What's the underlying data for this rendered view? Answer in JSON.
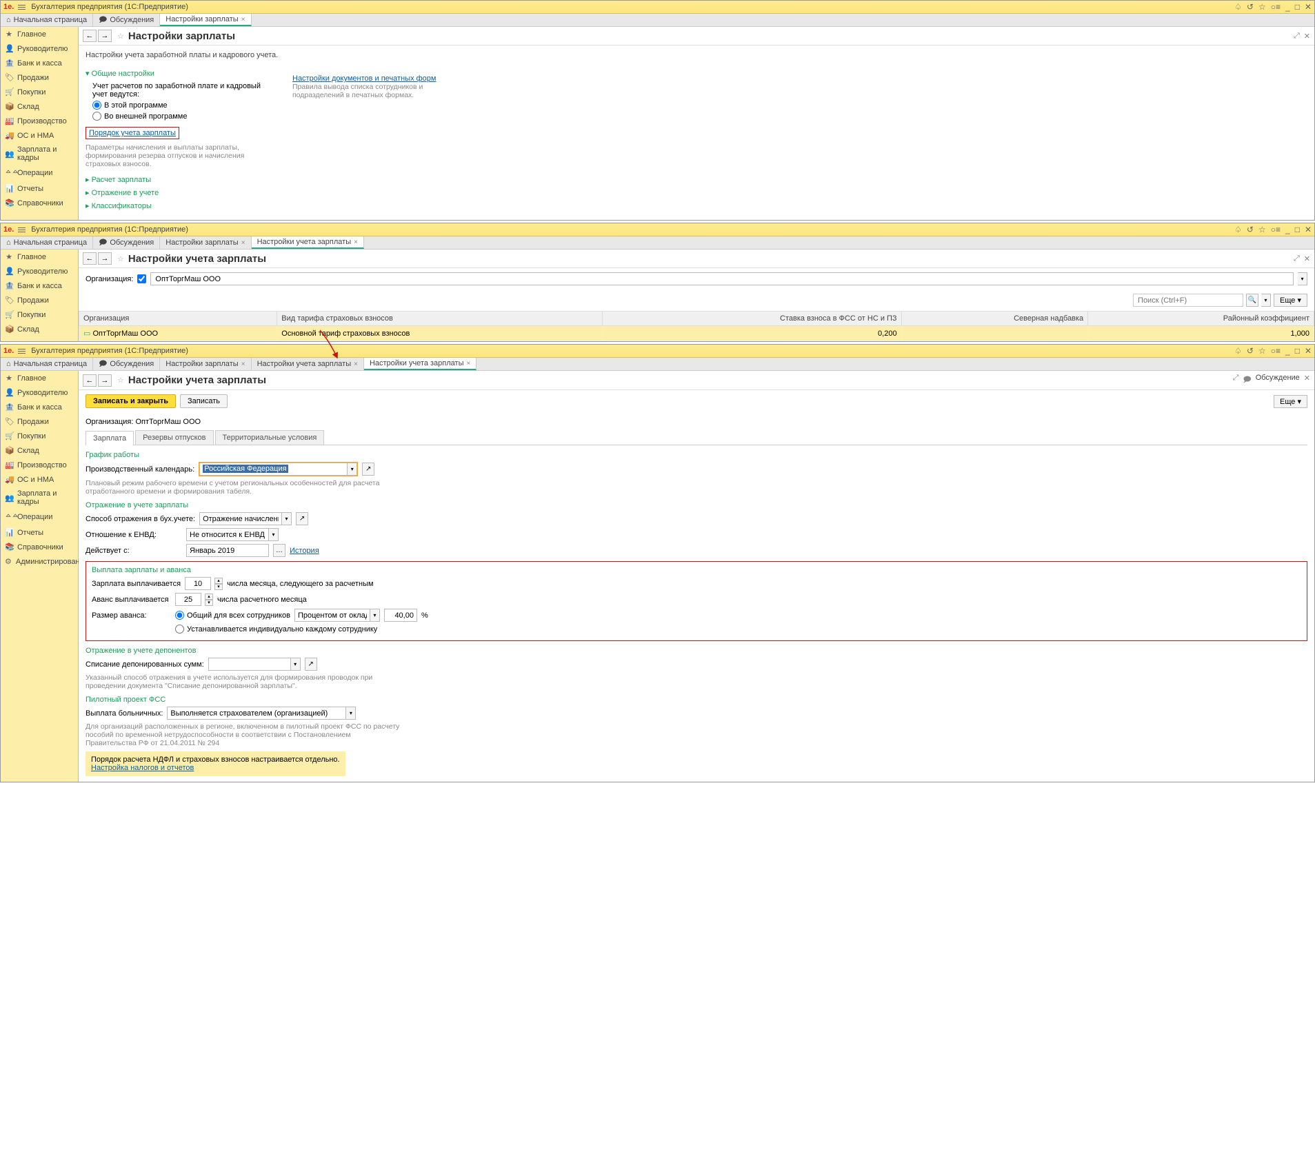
{
  "app_title": "Бухгалтерия предприятия  (1С:Предприятие)",
  "tabs": {
    "home": "Начальная страница",
    "discuss": "Обсуждения",
    "t1": "Настройки зарплаты",
    "t2": "Настройки учета зарплаты",
    "t3": "Настройки учета зарплаты"
  },
  "side": [
    "Главное",
    "Руководителю",
    "Банк и касса",
    "Продажи",
    "Покупки",
    "Склад",
    "Производство",
    "ОС и НМА",
    "Зарплата и кадры",
    "Операции",
    "Отчеты",
    "Справочники",
    "Администрирование"
  ],
  "icons": [
    "★",
    "👤",
    "🏦",
    "🏷",
    "🛒",
    "📦",
    "🏭",
    "🚚",
    "👥",
    "ᅀᅀ",
    "📊",
    "📚",
    "⚙"
  ],
  "w1": {
    "title": "Настройки зарплаты",
    "sub": "Настройки учета заработной платы и кадрового учета.",
    "s_general": "Общие настройки",
    "lead": "Учет расчетов по заработной плате и кадровый учет ведутся:",
    "r1": "В этой программе",
    "r2": "Во внешней программе",
    "link_order": "Порядок учета зарплаты",
    "hint_order": "Параметры начисления и выплаты зарплаты, формирования резерва отпусков и начисления страховых взносов.",
    "link_docs": "Настройки документов и печатных форм",
    "hint_docs": "Правила вывода списка сотрудников и подразделений в печатных формах.",
    "s_calc": "Расчет зарплаты",
    "s_refl": "Отражение в учете",
    "s_class": "Классификаторы"
  },
  "w2": {
    "title": "Настройки учета зарплаты",
    "org_label": "Организация:",
    "org_val": "ОптТоргМаш ООО",
    "search_ph": "Поиск (Ctrl+F)",
    "more": "Еще",
    "th": [
      "Организация",
      "Вид тарифа страховых взносов",
      "Ставка взноса в ФСС от НС и ПЗ",
      "Северная надбавка",
      "Районный коэффициент"
    ],
    "row": [
      "ОптТоргМаш ООО",
      "Основной тариф страховых взносов",
      "0,200",
      "",
      "1,000"
    ]
  },
  "w3": {
    "title": "Настройки учета зарплаты",
    "save_close": "Записать и закрыть",
    "save": "Записать",
    "more": "Еще",
    "discuss": "Обсуждение",
    "org_line": "Организация: ОптТоргМаш ООО",
    "subtabs": [
      "Зарплата",
      "Резервы отпусков",
      "Территориальные условия"
    ],
    "h_sched": "График работы",
    "cal_label": "Производственный календарь:",
    "cal_val": "Российская Федерация",
    "cal_hint": "Плановый режим рабочего времени с учетом региональных особенностей для расчета отработанного времени и формирования табеля.",
    "h_refl": "Отражение в учете зарплаты",
    "refl_label": "Способ отражения в бух.учете:",
    "refl_val": "Отражение начислений п...",
    "envd_label": "Отношение к ЕНВД:",
    "envd_val": "Не относится к ЕНВД",
    "since_label": "Действует с:",
    "since_val": "Январь 2019",
    "history": "История",
    "h_pay": "Выплата зарплаты и аванса",
    "sal_label": "Зарплата выплачивается",
    "sal_day": "10",
    "sal_suffix": "числа месяца, следующего за расчетным",
    "adv_label": "Аванс выплачивается",
    "adv_day": "25",
    "adv_suffix": "числа расчетного месяца",
    "adv_size": "Размер аванса:",
    "adv_r1": "Общий для всех сотрудников",
    "adv_r2": "Устанавливается индивидуально каждому сотруднику",
    "adv_mode": "Процентом от оклада",
    "adv_pct": "40,00",
    "pct": "%",
    "h_dep": "Отражение в учете депонентов",
    "dep_label": "Списание депонированных сумм:",
    "dep_hint": "Указанный способ отражения в учете используется для формирования проводок при проведении документа \"Списание депонированной зарплаты\".",
    "h_fss": "Пилотный проект ФСС",
    "fss_label": "Выплата больничных:",
    "fss_val": "Выполняется страхователем (организацией)",
    "fss_hint": "Для организаций расположенных в регионе, включенном в пилотный проект ФСС по расчету пособий по временной нетрудоспособности в соответствии с Постановлением Правительства РФ от 21.04.2011 № 294",
    "note1": "Порядок расчета НДФЛ и страховых взносов настраивается отдельно.",
    "note2": "Настройка налогов и отчетов"
  }
}
